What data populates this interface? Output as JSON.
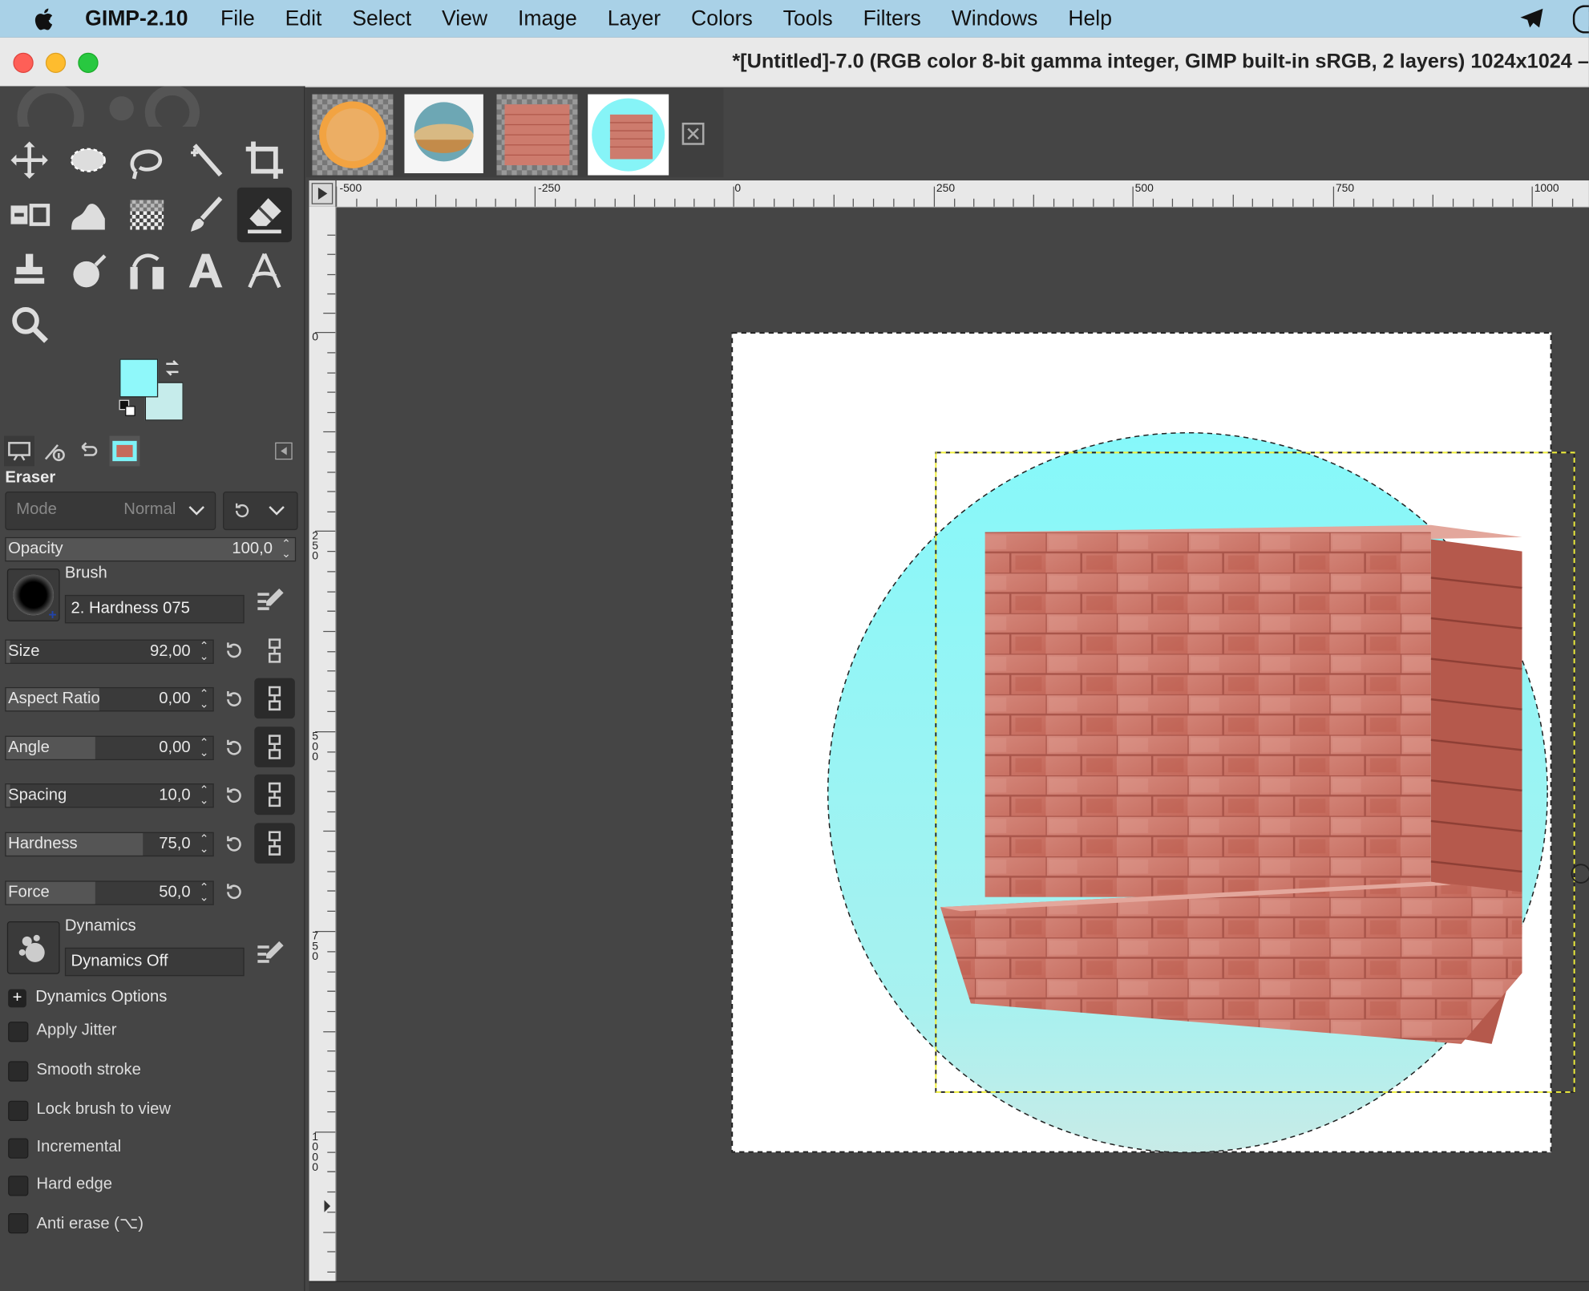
{
  "menubar": {
    "app_name": "GIMP-2.10",
    "items": [
      "File",
      "Edit",
      "Select",
      "View",
      "Image",
      "Layer",
      "Colors",
      "Tools",
      "Filters",
      "Windows",
      "Help"
    ]
  },
  "window": {
    "title": "*[Untitled]-7.0 (RGB color 8-bit gamma integer, GIMP built-in sRGB, 2 layers) 1024x1024 –"
  },
  "tool_options": {
    "title": "Eraser",
    "mode_label": "Mode",
    "mode_value": "Normal",
    "opacity": {
      "label": "Opacity",
      "value": "100,0",
      "fraction": 1.0
    },
    "brush_label": "Brush",
    "brush_name": "2. Hardness 075",
    "size": {
      "label": "Size",
      "value": "92,00",
      "fraction": 0.02
    },
    "aspect_ratio": {
      "label": "Aspect Ratio",
      "value": "0,00",
      "fraction": 0.45
    },
    "angle": {
      "label": "Angle",
      "value": "0,00",
      "fraction": 0.43
    },
    "spacing": {
      "label": "Spacing",
      "value": "10,0",
      "fraction": 0.02
    },
    "hardness": {
      "label": "Hardness",
      "value": "75,0",
      "fraction": 0.66
    },
    "force": {
      "label": "Force",
      "value": "50,0",
      "fraction": 0.43
    },
    "dynamics_label": "Dynamics",
    "dynamics_name": "Dynamics Off",
    "dynamics_options_label": "Dynamics Options",
    "checkboxes": [
      "Apply Jitter",
      "Smooth stroke",
      "Lock brush to view",
      "Incremental",
      "Hard edge",
      "Anti erase  (⌥)"
    ]
  },
  "colors": {
    "foreground": "#8ff8fa",
    "background": "#c6eceb"
  },
  "ruler": {
    "h_labels": [
      "-500",
      "-250",
      "0",
      "250",
      "500",
      "750",
      "1000"
    ],
    "v_labels": [
      "0",
      "250",
      "500",
      "750",
      "1000"
    ]
  }
}
